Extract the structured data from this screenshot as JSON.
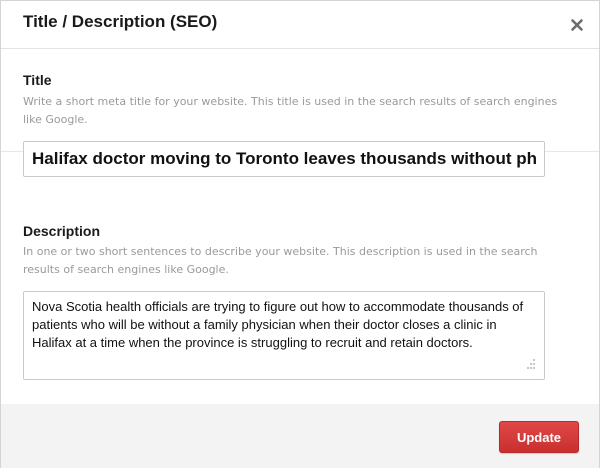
{
  "dialog": {
    "title": "Title / Description (SEO)",
    "close_icon": "close-icon"
  },
  "title_section": {
    "label": "Title",
    "help": "Write a short meta title for your website. This title is used in the search results of search engines like Google.",
    "value": "Halifax doctor moving to Toronto leaves thousands without physician"
  },
  "description_section": {
    "label": "Description",
    "help": "In one or two short sentences to describe your website. This description is used in the search results of search engines like Google.",
    "value": "Nova Scotia health officials are trying to figure out how to accommodate thousands of patients who will be without a family physician when their doctor closes a clinic in Halifax at a time when the province is struggling to recruit and retain doctors."
  },
  "footer": {
    "update_label": "Update",
    "update_color": "#d43c3c"
  }
}
